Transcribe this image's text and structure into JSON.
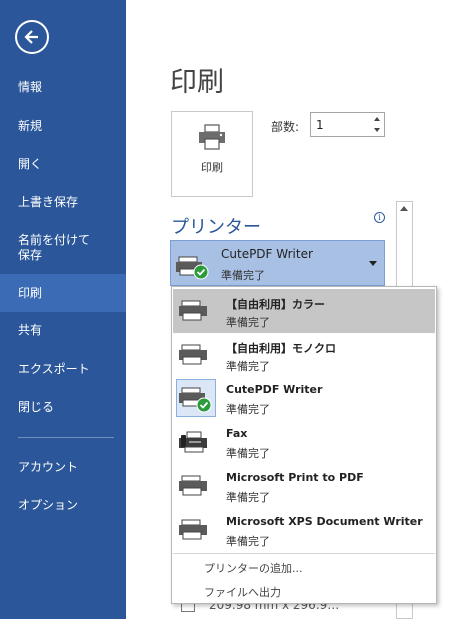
{
  "sidebar": {
    "items": [
      {
        "label": "情報"
      },
      {
        "label": "新規"
      },
      {
        "label": "開く"
      },
      {
        "label": "上書き保存"
      },
      {
        "label": "名前を付けて\n保存"
      },
      {
        "label": "印刷"
      },
      {
        "label": "共有"
      },
      {
        "label": "エクスポート"
      },
      {
        "label": "閉じる"
      },
      {
        "label": "アカウント"
      },
      {
        "label": "オプション"
      }
    ],
    "active": "印刷"
  },
  "main": {
    "title": "印刷",
    "print_button_label": "印刷",
    "copies_label": "部数:",
    "copies_value": "1",
    "printer_heading": "プリンター",
    "info_glyph": "i",
    "selected_printer": {
      "name": "CutePDF Writer",
      "status": "準備完了"
    },
    "paper_size_partial": "209.98 mm x 296.9…"
  },
  "printer_dropdown": {
    "items": [
      {
        "name": "【自由利用】カラー",
        "status": "準備完了",
        "icon": "printer-icon"
      },
      {
        "name": "【自由利用】モノクロ",
        "status": "準備完了",
        "icon": "printer-icon"
      },
      {
        "name": "CutePDF Writer",
        "status": "準備完了",
        "icon": "printer-default-check-icon"
      },
      {
        "name": "Fax",
        "status": "準備完了",
        "icon": "fax-icon"
      },
      {
        "name": "Microsoft Print to PDF",
        "status": "準備完了",
        "icon": "printer-icon"
      },
      {
        "name": "Microsoft XPS Document Writer",
        "status": "準備完了",
        "icon": "printer-icon"
      }
    ],
    "hovered_index": 0,
    "add_printer": "プリンターの追加...",
    "print_to_file": "ファイルへ出力"
  },
  "colors": {
    "sidebar_bg": "#2b579a",
    "sidebar_active": "#3b6bb5",
    "accent": "#2b579a",
    "selected_bg": "#a7c0e4",
    "hover_bg": "#c6c6c6"
  }
}
